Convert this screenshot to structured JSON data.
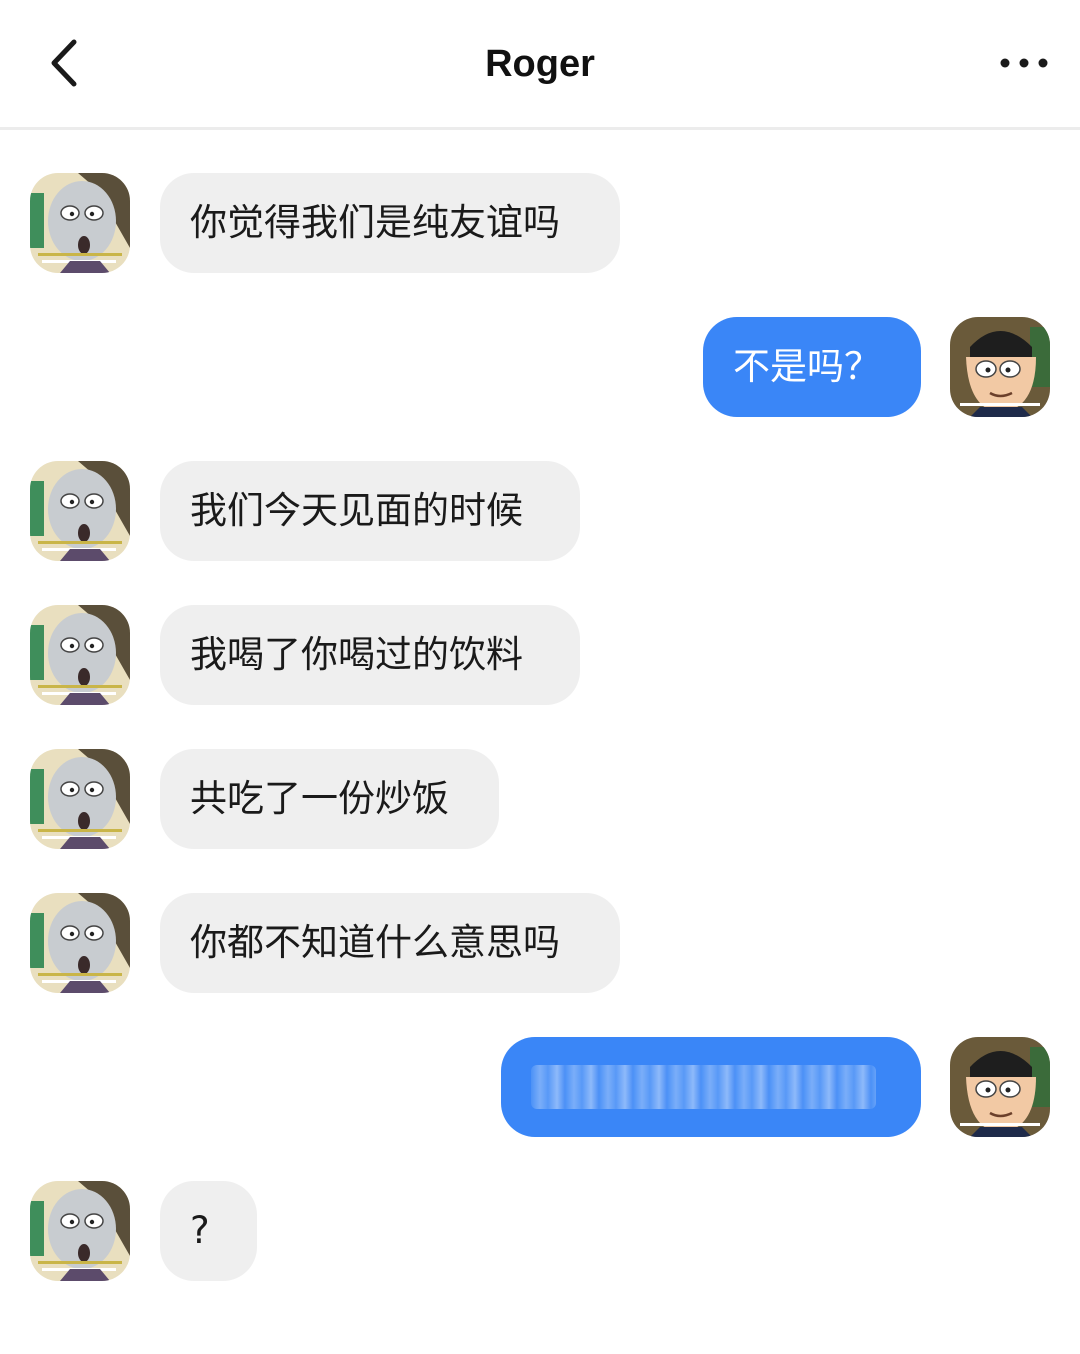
{
  "header": {
    "title": "Roger",
    "back_icon": "chevron-left-icon",
    "more_icon": "more-horizontal-icon"
  },
  "colors": {
    "accent": "#3a86f7",
    "incoming_bubble": "#efefef",
    "background": "#ffffff"
  },
  "messages": [
    {
      "side": "left",
      "text": "你觉得我们是纯友谊吗"
    },
    {
      "side": "right",
      "text": "不是吗？"
    },
    {
      "side": "left",
      "text": "我们今天见面的时候"
    },
    {
      "side": "left",
      "text": "我喝了你喝过的饮料"
    },
    {
      "side": "left",
      "text": "共吃了一份炒饭"
    },
    {
      "side": "left",
      "text": "你都不知道什么意思吗"
    },
    {
      "side": "right",
      "text": "",
      "redacted": true
    },
    {
      "side": "left",
      "text": "?"
    }
  ]
}
